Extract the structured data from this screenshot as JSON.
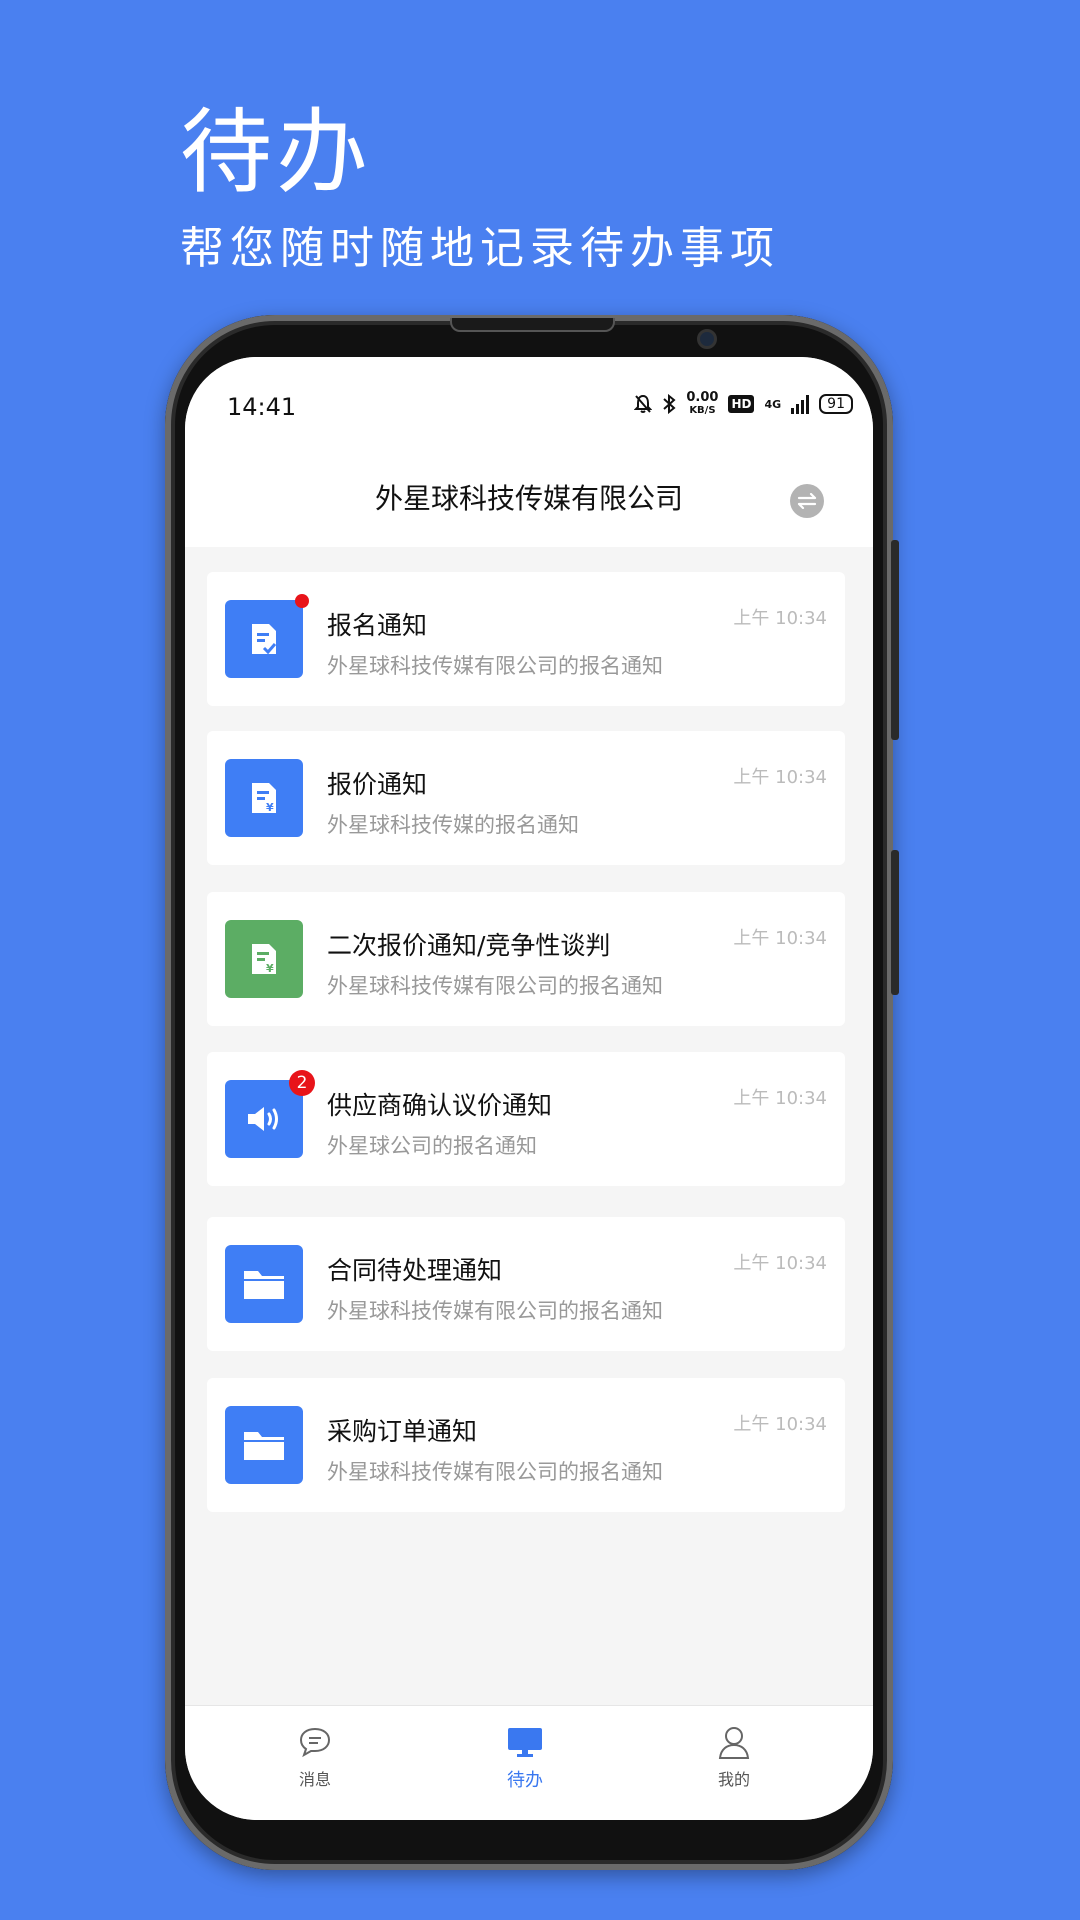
{
  "hero": {
    "title": "待办",
    "subtitle": "帮您随时随地记录待办事项"
  },
  "status_bar": {
    "time": "14:41",
    "speed_value": "0.00",
    "speed_unit": "KB/S",
    "hd": "HD",
    "network": "4G",
    "battery": "91"
  },
  "header": {
    "title": "外星球科技传媒有限公司"
  },
  "notices": [
    {
      "title": "报名通知",
      "subtitle": "外星球科技传媒有限公司的报名通知",
      "time": "上午 10:34",
      "icon": "document-check-icon",
      "color": "#3f7ef5",
      "badge": "dot"
    },
    {
      "title": "报价通知",
      "subtitle": "外星球科技传媒的报名通知",
      "time": "上午 10:34",
      "icon": "document-yen-icon",
      "color": "#3f7ef5",
      "badge": ""
    },
    {
      "title": "二次报价通知/竞争性谈判",
      "subtitle": "外星球科技传媒有限公司的报名通知",
      "time": "上午 10:34",
      "icon": "document-yen-icon",
      "color": "#5cad64",
      "badge": ""
    },
    {
      "title": "供应商确认议价通知",
      "subtitle": "外星球公司的报名通知",
      "time": "上午 10:34",
      "icon": "speaker-icon",
      "color": "#3f7ef5",
      "badge": "2"
    },
    {
      "title": "合同待处理通知",
      "subtitle": "外星球科技传媒有限公司的报名通知",
      "time": "上午 10:34",
      "icon": "folder-icon",
      "color": "#3f7ef5",
      "badge": ""
    },
    {
      "title": "采购订单通知",
      "subtitle": "外星球科技传媒有限公司的报名通知",
      "time": "上午 10:34",
      "icon": "folder-icon",
      "color": "#3f7ef5",
      "badge": ""
    }
  ],
  "tabbar": {
    "messages": "消息",
    "todo": "待办",
    "mine": "我的",
    "active": "todo",
    "active_color": "#3a78f0"
  }
}
